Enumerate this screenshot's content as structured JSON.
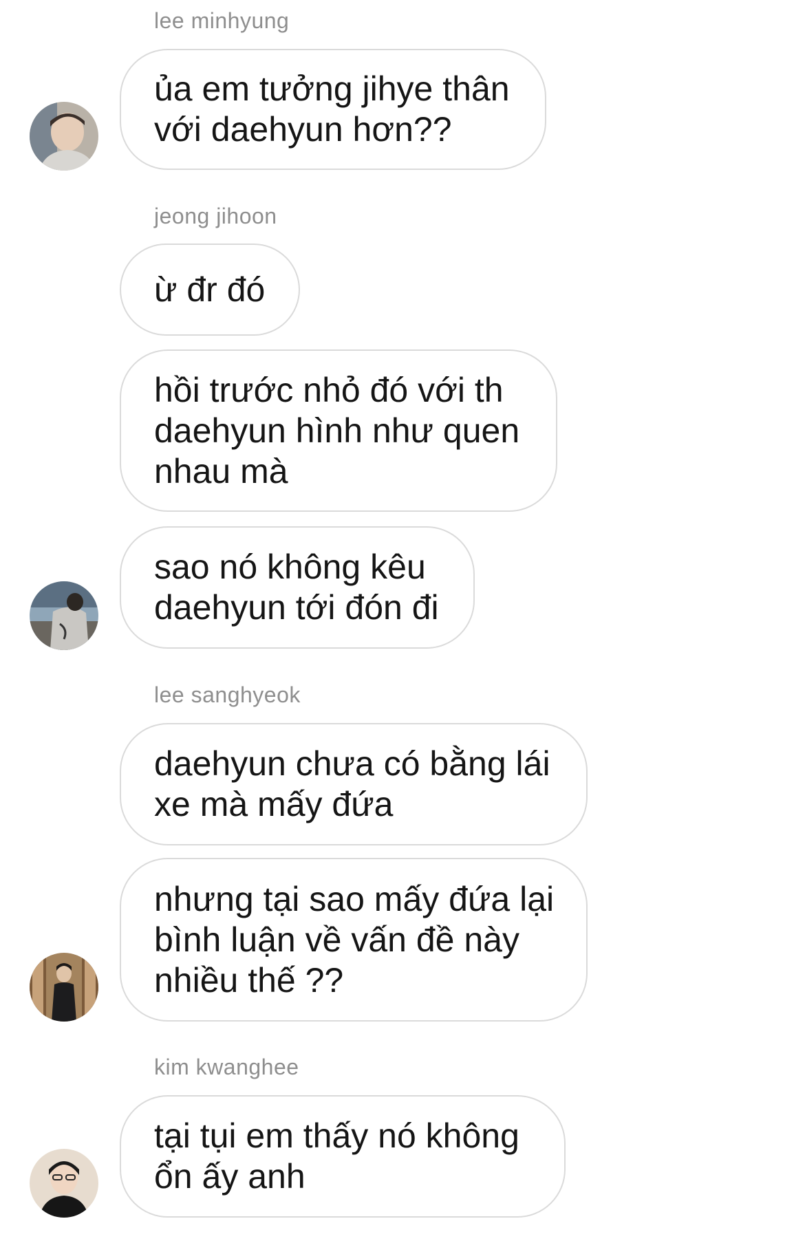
{
  "chat": {
    "groups": [
      {
        "sender": "lee minhyung",
        "messages": [
          {
            "lines": [
              "ủa em tưởng jihye thân",
              "với daehyun hơn??"
            ]
          }
        ]
      },
      {
        "sender": "jeong jihoon",
        "messages": [
          {
            "lines": [
              "ừ đr đó"
            ]
          },
          {
            "lines": [
              "hồi trước nhỏ đó với th",
              "daehyun hình như quen",
              "nhau mà"
            ]
          },
          {
            "lines": [
              "sao nó không kêu",
              "daehyun tới đón đi"
            ]
          }
        ]
      },
      {
        "sender": "lee sanghyeok",
        "messages": [
          {
            "lines": [
              "daehyun chưa có bằng lái",
              "xe mà mấy đứa"
            ]
          },
          {
            "lines": [
              "nhưng tại sao mấy đứa lại",
              "bình luận về vấn đề này",
              "nhiều thế ??"
            ]
          }
        ]
      },
      {
        "sender": "kim kwanghee",
        "messages": [
          {
            "lines": [
              "tại tụi em thấy nó không",
              "ổn ấy anh"
            ]
          }
        ]
      }
    ]
  },
  "colors": {
    "bubble_border": "#dadada",
    "sender_text": "#8e8e8e",
    "message_text": "#151515",
    "background": "#ffffff"
  }
}
